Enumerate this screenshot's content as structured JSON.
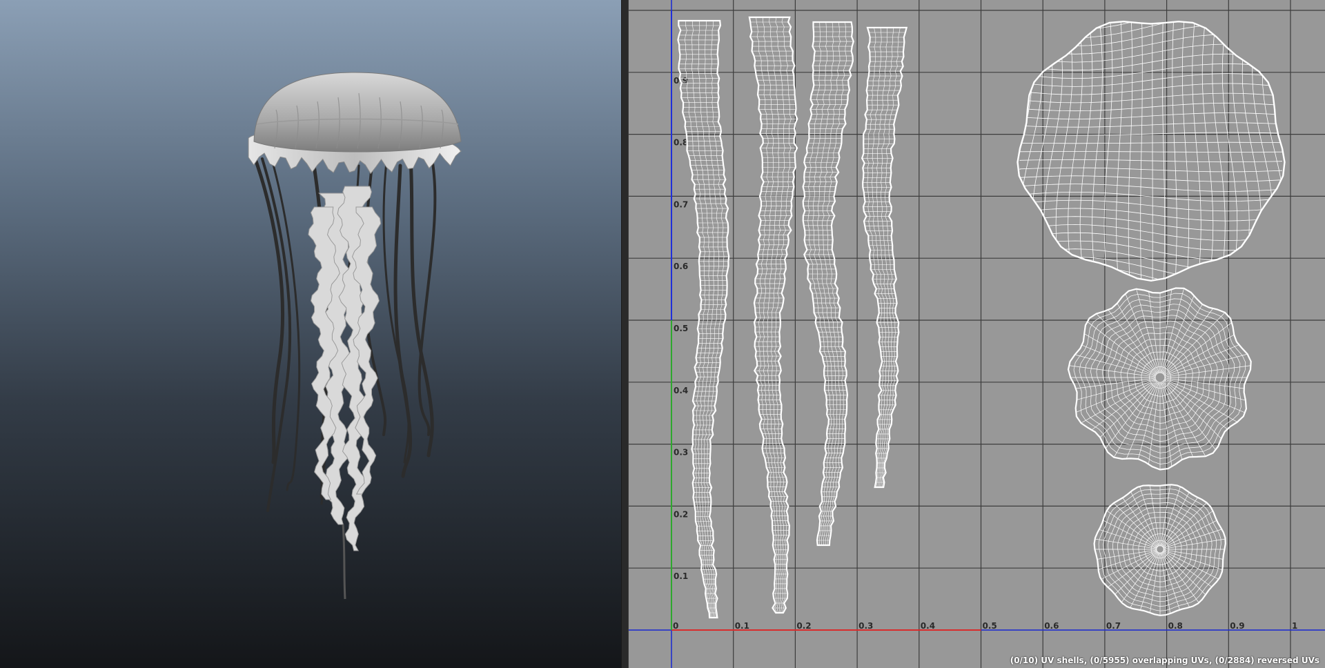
{
  "viewport": {
    "background_top": "#8b9fb5",
    "background_bottom": "#141619",
    "model_icon": "jellyfish-model"
  },
  "uv_editor": {
    "background": "#989898",
    "grid_color": "#3c3c3c",
    "wire_color": "#ffffff",
    "u_axis_color": "#d92b2b",
    "v_axis_color": "#2ea82e",
    "border_axis_color": "#1f2fd9",
    "u_ticks": [
      "0",
      "0.1",
      "0.2",
      "0.3",
      "0.4",
      "0.5",
      "0.6",
      "0.7",
      "0.8",
      "0.9",
      "1"
    ],
    "v_ticks": [
      "0.1",
      "0.2",
      "0.3",
      "0.4",
      "0.5",
      "0.6",
      "0.7",
      "0.8",
      "0.9"
    ],
    "status": "(0/10) UV shells, (0/5955) overlapping UVs, (0/2884) reversed UVs"
  }
}
